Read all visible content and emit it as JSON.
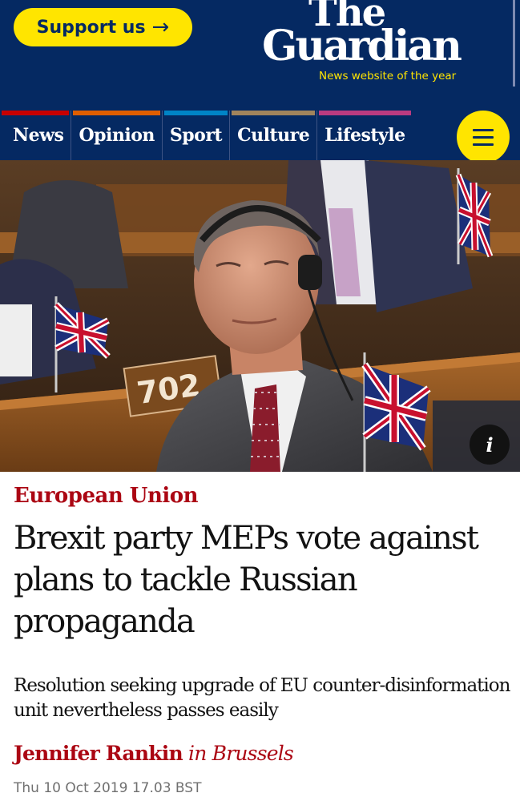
{
  "header": {
    "support_label": "Support us",
    "support_arrow": "→",
    "logo_the": "The",
    "logo_guardian": "Guardian",
    "tagline": "News website of the year",
    "background": "#052962",
    "accent": "#ffe500"
  },
  "nav": {
    "pillars": [
      {
        "label": "News",
        "color": "#c70000"
      },
      {
        "label": "Opinion",
        "color": "#e05e00"
      },
      {
        "label": "Sport",
        "color": "#0084c6"
      },
      {
        "label": "Culture",
        "color": "#a1845c"
      },
      {
        "label": "Lifestyle",
        "color": "#bb3b80"
      }
    ],
    "menu_icon": "hamburger-menu-icon"
  },
  "hero": {
    "seat_number": "702",
    "info_label": "i",
    "info_icon": "info-icon"
  },
  "article": {
    "section": "European Union",
    "headline": "Brexit party MEPs vote against plans to tackle Russian propaganda",
    "standfirst": "Resolution seeking upgrade of EU counter-disinformation unit nevertheless passes easily",
    "author": "Jennifer Rankin",
    "location": "in Brussels",
    "date": "Thu 10 Oct 2019 17.03 BST",
    "kicker_color": "#ab0613"
  }
}
